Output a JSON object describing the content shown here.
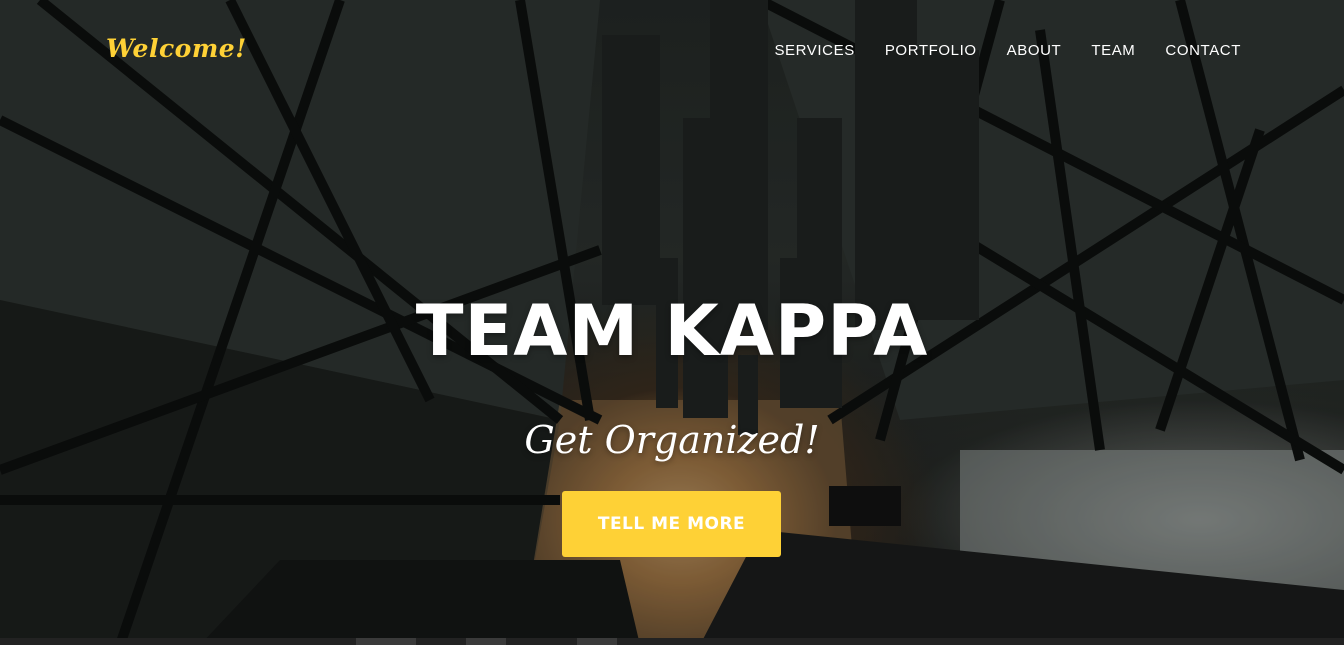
{
  "navbar": {
    "brand": "Welcome!",
    "links": [
      "SERVICES",
      "PORTFOLIO",
      "ABOUT",
      "TEAM",
      "CONTACT"
    ]
  },
  "hero": {
    "heading": "TEAM KAPPA",
    "subheading": "Get Organized!",
    "cta_label": "TELL ME MORE"
  },
  "colors": {
    "accent": "#fed136",
    "text": "#ffffff"
  }
}
